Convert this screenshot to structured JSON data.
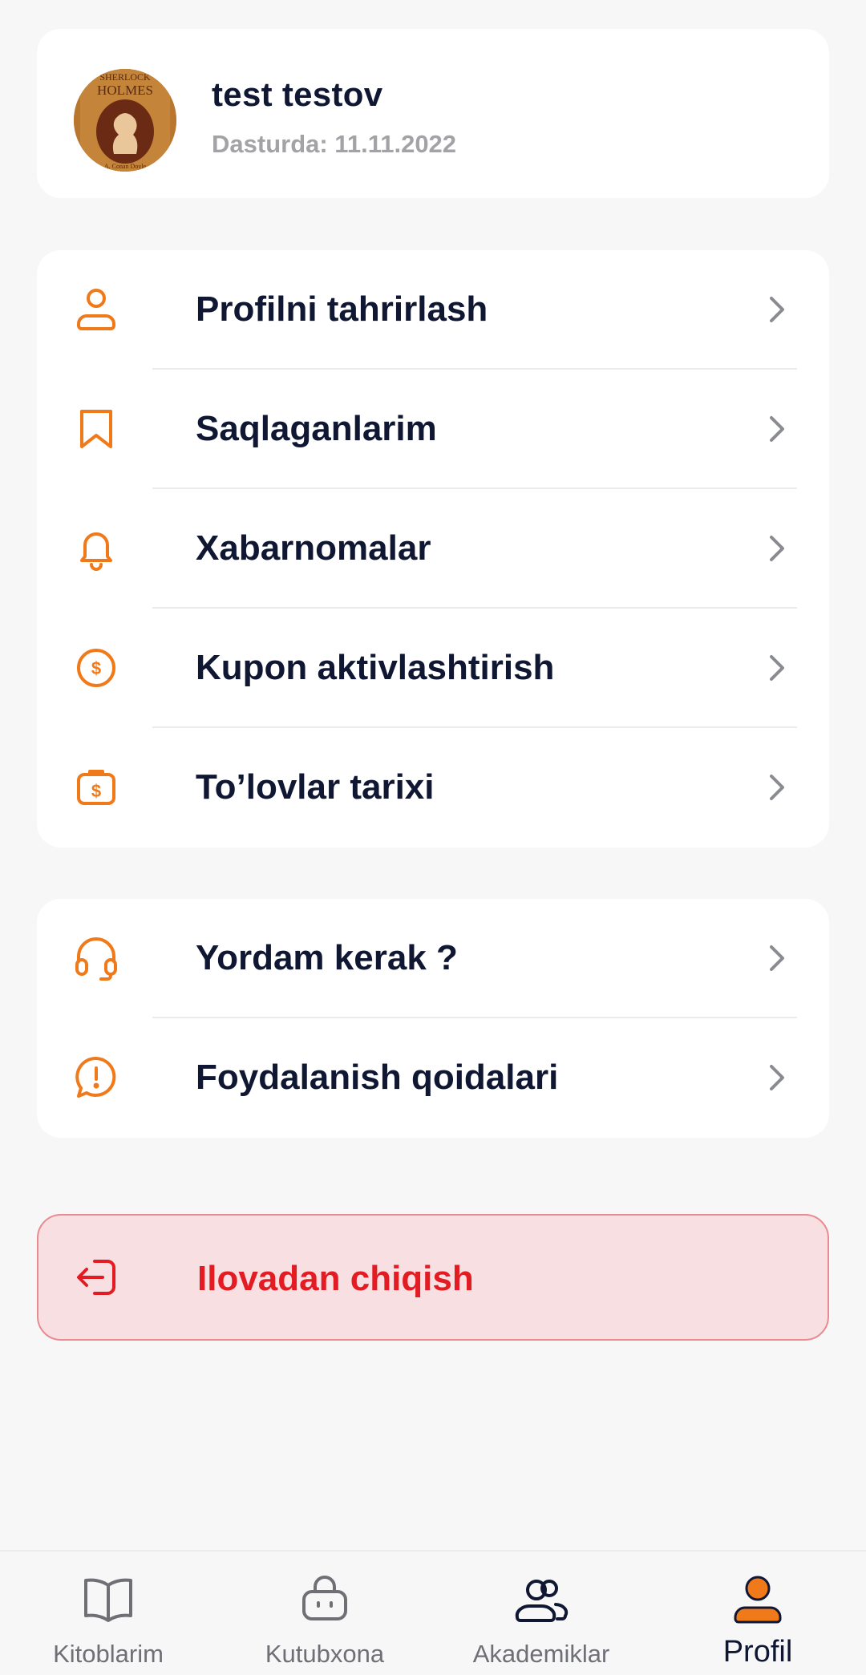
{
  "colors": {
    "accent": "#f07a1a",
    "text_primary": "#101733",
    "text_muted": "#a3a3a7",
    "danger": "#e31b23",
    "danger_bg": "#f8e0e2",
    "chevron": "#8a8b90",
    "nav_inactive": "#6f7076"
  },
  "profile": {
    "name": "test testov",
    "member_since": "Dasturda: 11.11.2022",
    "avatar_icon": "book-cover-avatar"
  },
  "menu_primary": [
    {
      "label": "Profilni tahrirlash",
      "icon": "user-icon"
    },
    {
      "label": "Saqlaganlarim",
      "icon": "bookmark-icon"
    },
    {
      "label": "Xabarnomalar",
      "icon": "bell-icon"
    },
    {
      "label": "Kupon aktivlashtirish",
      "icon": "dollar-coin-icon"
    },
    {
      "label": "To’lovlar tarixi",
      "icon": "wallet-dollar-icon"
    }
  ],
  "menu_secondary": [
    {
      "label": "Yordam kerak ?",
      "icon": "headset-icon"
    },
    {
      "label": "Foydalanish qoidalari",
      "icon": "alert-message-icon"
    }
  ],
  "logout": {
    "label": "Ilovadan chiqish",
    "icon": "logout-icon"
  },
  "bottom_nav": [
    {
      "label": "Kitoblarim",
      "icon": "open-book-icon",
      "active": false
    },
    {
      "label": "Kutubxona",
      "icon": "shopping-bag-icon",
      "active": false
    },
    {
      "label": "Akademiklar",
      "icon": "users-icon",
      "active": false
    },
    {
      "label": "Profil",
      "icon": "profile-filled-icon",
      "active": true
    }
  ]
}
